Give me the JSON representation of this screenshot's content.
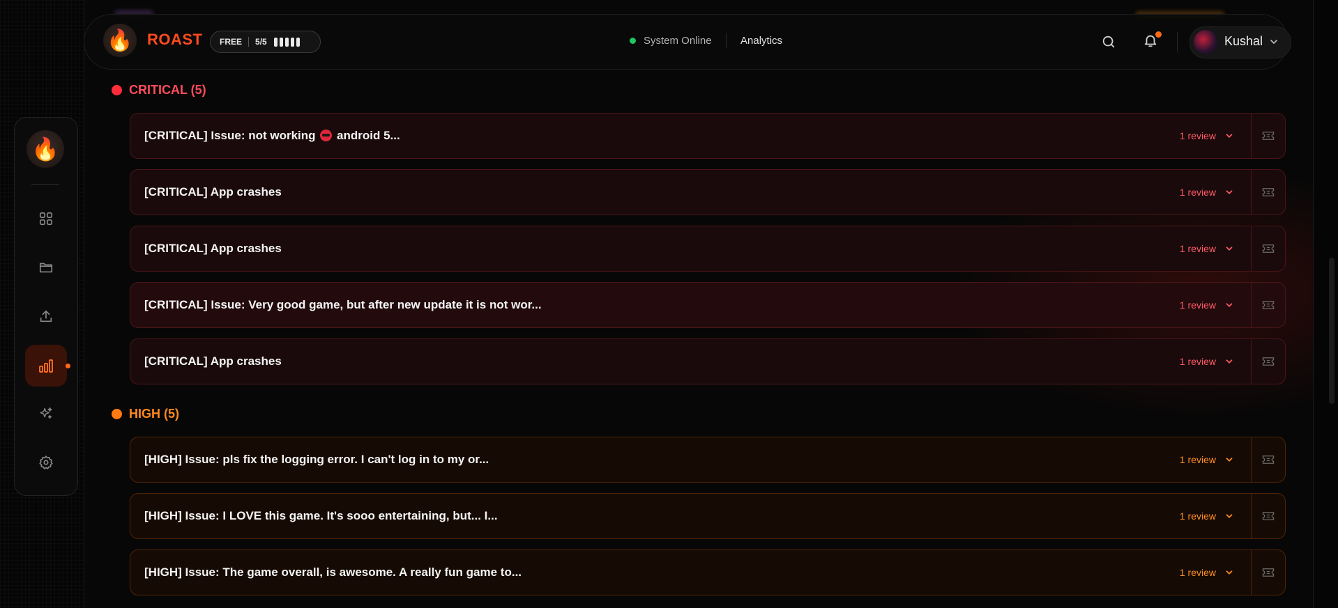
{
  "header": {
    "brand": "ROAST",
    "plan": {
      "label": "FREE",
      "usage": "5/5",
      "usage_fraction": 1.0
    },
    "status": "System Online",
    "nav_link": "Analytics",
    "user": {
      "name": "Kushal"
    }
  },
  "sidebar": {
    "items": [
      {
        "name": "dashboard",
        "icon": "grid-icon"
      },
      {
        "name": "projects",
        "icon": "folder-icon"
      },
      {
        "name": "upload",
        "icon": "upload-icon"
      },
      {
        "name": "analytics",
        "icon": "bar-chart-icon",
        "active": true
      },
      {
        "name": "ai",
        "icon": "sparkles-icon"
      },
      {
        "name": "settings",
        "icon": "gear-icon"
      }
    ]
  },
  "sections": {
    "critical": {
      "label": "CRITICAL (5)",
      "color": "#ff2d3a",
      "rows": [
        {
          "title_pre": "[CRITICAL] Issue: not working",
          "title_post": "android 5...",
          "count": "1 review"
        },
        {
          "title": "[CRITICAL] App crashes",
          "count": "1 review"
        },
        {
          "title": "[CRITICAL] App crashes",
          "count": "1 review"
        },
        {
          "title": "[CRITICAL] Issue: Very good game, but after new update it is not wor...",
          "count": "1 review"
        },
        {
          "title": "[CRITICAL] App crashes",
          "count": "1 review"
        }
      ]
    },
    "high": {
      "label": "HIGH (5)",
      "color": "#ff7a10",
      "rows": [
        {
          "title": "[HIGH] Issue: pls fix the logging error. I can't log in to my or...",
          "count": "1 review"
        },
        {
          "title": "[HIGH] Issue: I LOVE this game. It's sooo entertaining, but... I...",
          "count": "1 review"
        },
        {
          "title": "[HIGH] Issue: The game overall, is awesome. A really fun game to...",
          "count": "1 review"
        }
      ]
    }
  }
}
